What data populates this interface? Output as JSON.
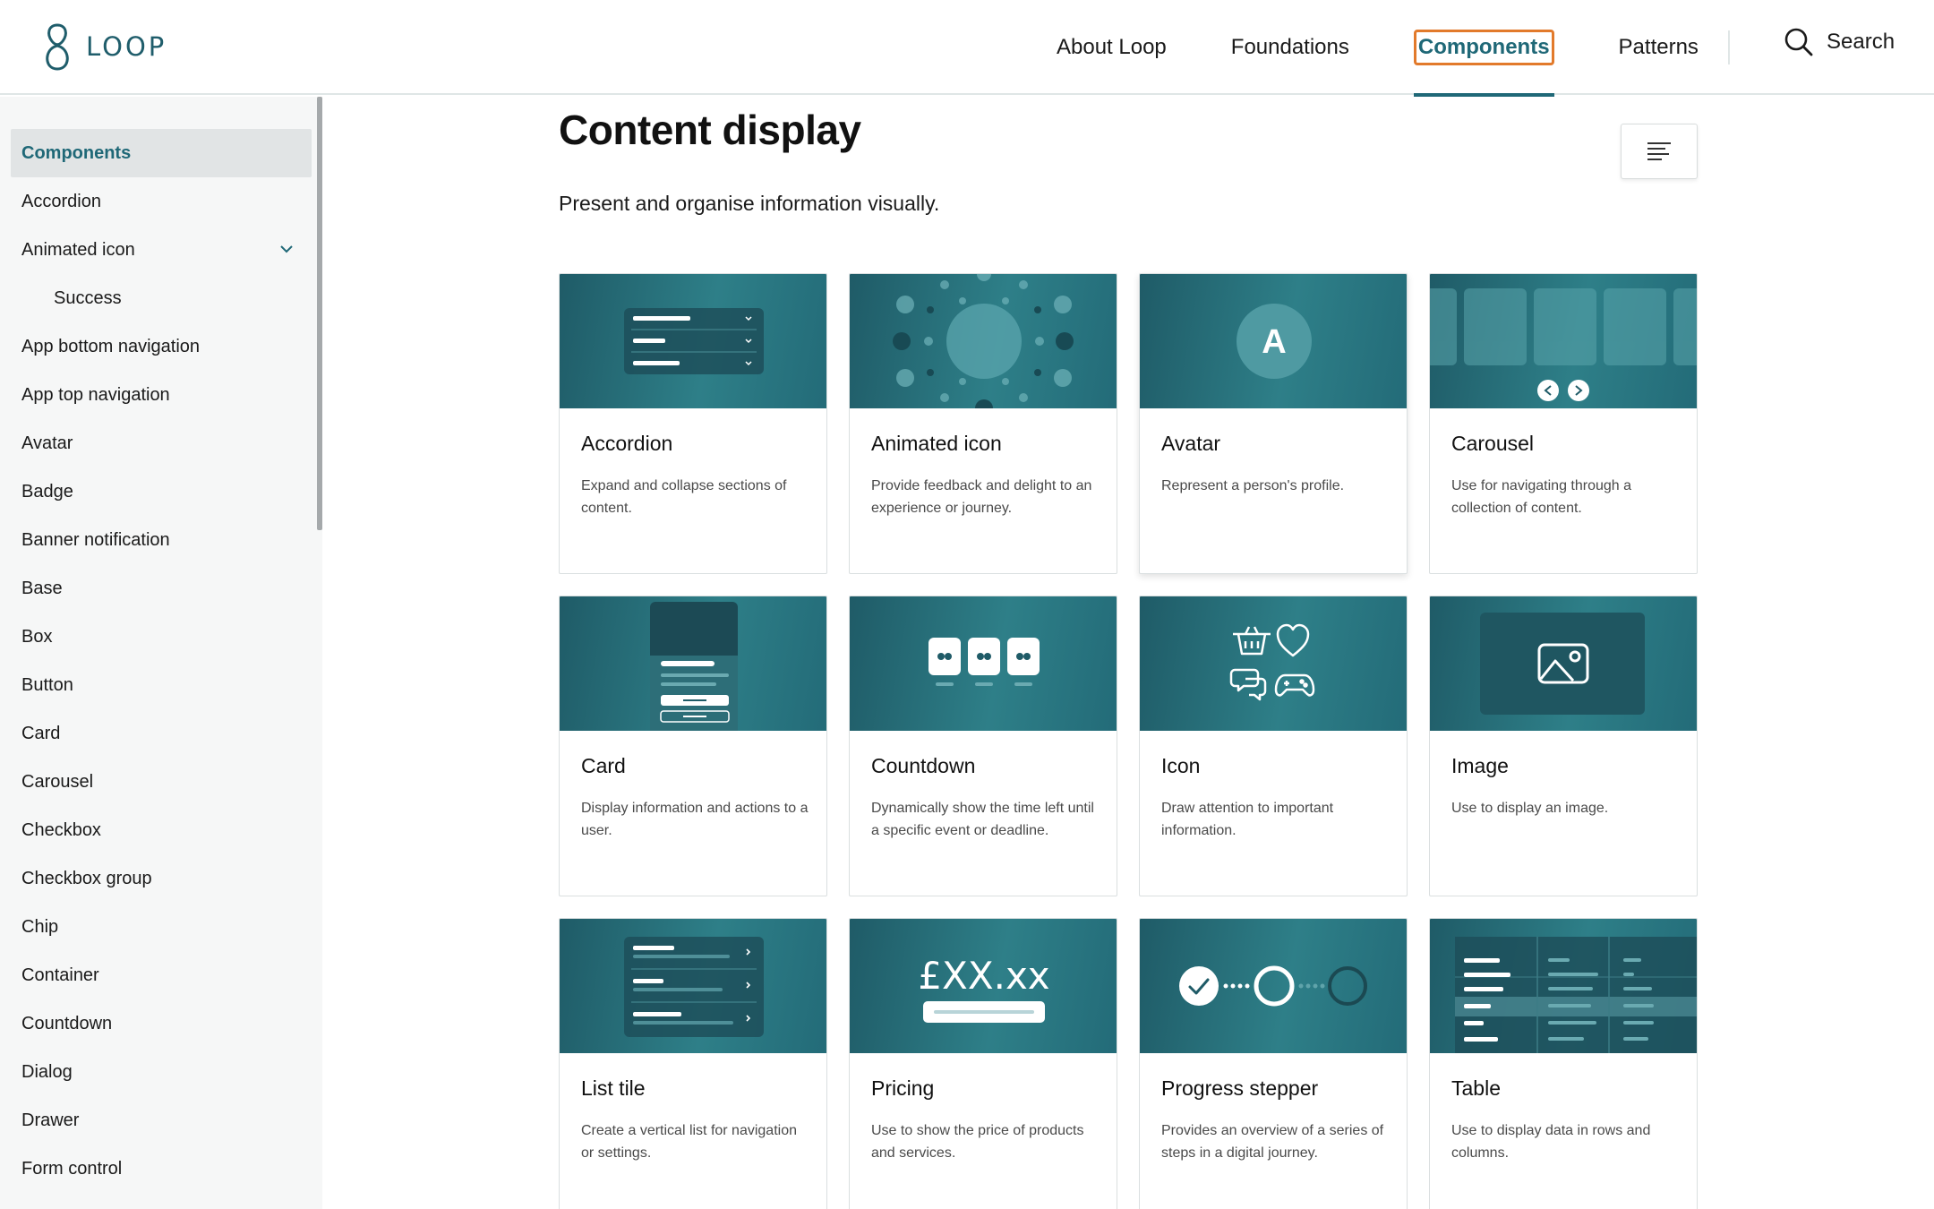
{
  "header": {
    "logo_text": "LOOP",
    "nav": [
      {
        "label": "About Loop"
      },
      {
        "label": "Foundations"
      },
      {
        "label": "Components"
      },
      {
        "label": "Patterns"
      }
    ],
    "search_label": "Search"
  },
  "sidebar": {
    "items": [
      {
        "label": "Components"
      },
      {
        "label": "Accordion"
      },
      {
        "label": "Animated icon"
      },
      {
        "label": "Success"
      },
      {
        "label": "App bottom navigation"
      },
      {
        "label": "App top navigation"
      },
      {
        "label": "Avatar"
      },
      {
        "label": "Badge"
      },
      {
        "label": "Banner notification"
      },
      {
        "label": "Base"
      },
      {
        "label": "Box"
      },
      {
        "label": "Button"
      },
      {
        "label": "Card"
      },
      {
        "label": "Carousel"
      },
      {
        "label": "Checkbox"
      },
      {
        "label": "Checkbox group"
      },
      {
        "label": "Chip"
      },
      {
        "label": "Container"
      },
      {
        "label": "Countdown"
      },
      {
        "label": "Dialog"
      },
      {
        "label": "Drawer"
      },
      {
        "label": "Form control"
      }
    ]
  },
  "main": {
    "title": "Content display",
    "description": "Present and organise information visually.",
    "cards": [
      {
        "title": "Accordion",
        "description": "Expand and collapse sections of content."
      },
      {
        "title": "Animated icon",
        "description": "Provide feedback and delight to an experience or journey."
      },
      {
        "title": "Avatar",
        "description": "Represent a person's profile.",
        "avatar_letter": "A"
      },
      {
        "title": "Carousel",
        "description": "Use for navigating through a collection of content."
      },
      {
        "title": "Card",
        "description": "Display information and actions to a user."
      },
      {
        "title": "Countdown",
        "description": "Dynamically show the time left until a specific event or deadline."
      },
      {
        "title": "Icon",
        "description": "Draw attention to important information."
      },
      {
        "title": "Image",
        "description": "Use to display an image."
      },
      {
        "title": "List tile",
        "description": "Create a vertical list for navigation or settings."
      },
      {
        "title": "Pricing",
        "description": "Use to show the price of products and services.",
        "price_text": "£XX.xx"
      },
      {
        "title": "Progress stepper",
        "description": "Provides an overview of a series of steps in a digital journey."
      },
      {
        "title": "Table",
        "description": "Use to display data in rows and columns."
      }
    ]
  },
  "colors": {
    "brand": "#1f6877",
    "focus_ring": "#e27a2b",
    "card_image": "#2e7f88"
  },
  "icons": [
    "loop-logo-icon",
    "search-icon",
    "chevron-down-icon",
    "table-of-contents-icon"
  ]
}
